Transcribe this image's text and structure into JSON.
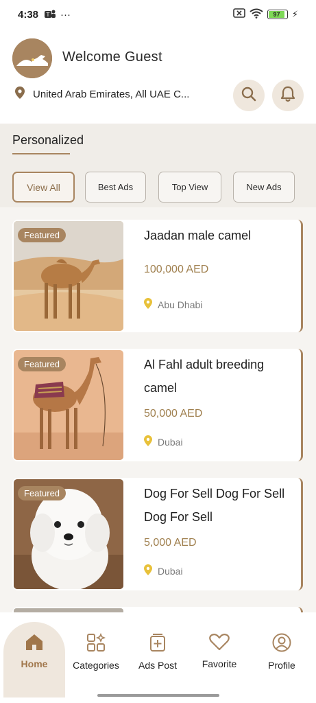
{
  "status_bar": {
    "time": "4:38",
    "more": "···",
    "battery": "97"
  },
  "header": {
    "welcome": "Welcome Guest",
    "location": "United Arab Emirates, All UAE C..."
  },
  "section": {
    "title": "Personalized"
  },
  "filters": [
    "View All",
    "Best Ads",
    "Top View",
    "New Ads"
  ],
  "listings": [
    {
      "badge": "Featured",
      "title": "Jaadan male camel",
      "price": "100,000 AED",
      "location": "Abu Dhabi"
    },
    {
      "badge": "Featured",
      "title": "Al Fahl adult breeding camel",
      "price": "50,000 AED",
      "location": "Dubai"
    },
    {
      "badge": "Featured",
      "title": "Dog For Sell Dog For Sell Dog For Sell",
      "price": "5,000 AED",
      "location": "Dubai"
    }
  ],
  "nav": [
    "Home",
    "Categories",
    "Ads Post",
    "Favorite",
    "Profile"
  ],
  "colors": {
    "accent": "#a88560",
    "price": "#a0804f",
    "pin": "#e8c13a"
  }
}
